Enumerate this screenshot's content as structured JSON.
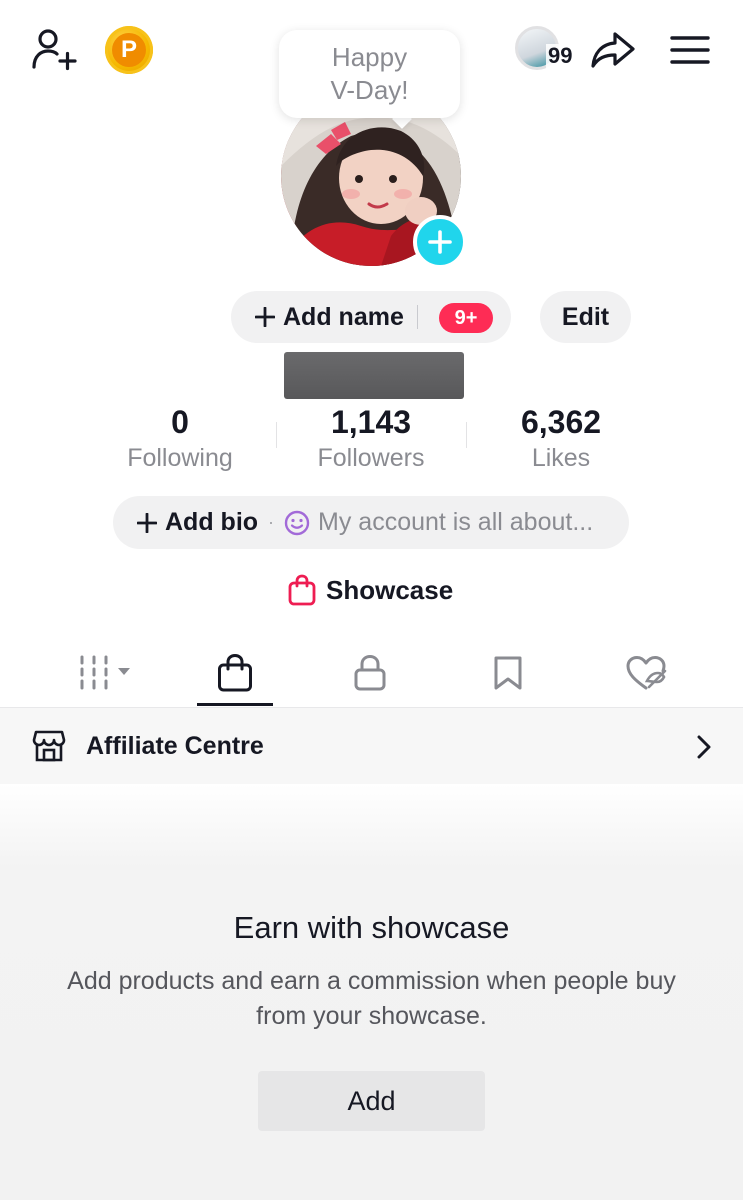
{
  "header": {
    "add_friend_icon": "add-user-icon",
    "coin_letter": "P",
    "story_count": "99",
    "share_icon": "share-arrow-icon",
    "menu_icon": "hamburger-menu-icon"
  },
  "bubble": {
    "line1": "Happy",
    "line2": "V-Day!"
  },
  "profile": {
    "add_name_label": "Add name",
    "notification_badge": "9+",
    "edit_label": "Edit"
  },
  "stats": {
    "following": {
      "value": "0",
      "label": "Following"
    },
    "followers": {
      "value": "1,143",
      "label": "Followers"
    },
    "likes": {
      "value": "6,362",
      "label": "Likes"
    }
  },
  "bio": {
    "add_label": "Add bio",
    "separator": "·",
    "placeholder": "My account is all about..."
  },
  "showcase": {
    "label": "Showcase"
  },
  "tabs": [
    {
      "id": "videos",
      "icon": "grid-icon"
    },
    {
      "id": "shop",
      "icon": "shopping-bag-icon",
      "active": true
    },
    {
      "id": "private",
      "icon": "lock-icon"
    },
    {
      "id": "saved",
      "icon": "bookmark-icon"
    },
    {
      "id": "liked",
      "icon": "heart-hidden-icon"
    }
  ],
  "affiliate": {
    "label": "Affiliate Centre"
  },
  "empty_state": {
    "title": "Earn with showcase",
    "description": "Add products and earn a commission when people buy from your showcase.",
    "button_label": "Add"
  },
  "colors": {
    "accent_cyan": "#20d5ec",
    "badge_red": "#fe2c55",
    "showcase_pink": "#ee1d52",
    "bio_emoji_purple": "#a26ad8",
    "coin_gold": "#f5b800"
  }
}
